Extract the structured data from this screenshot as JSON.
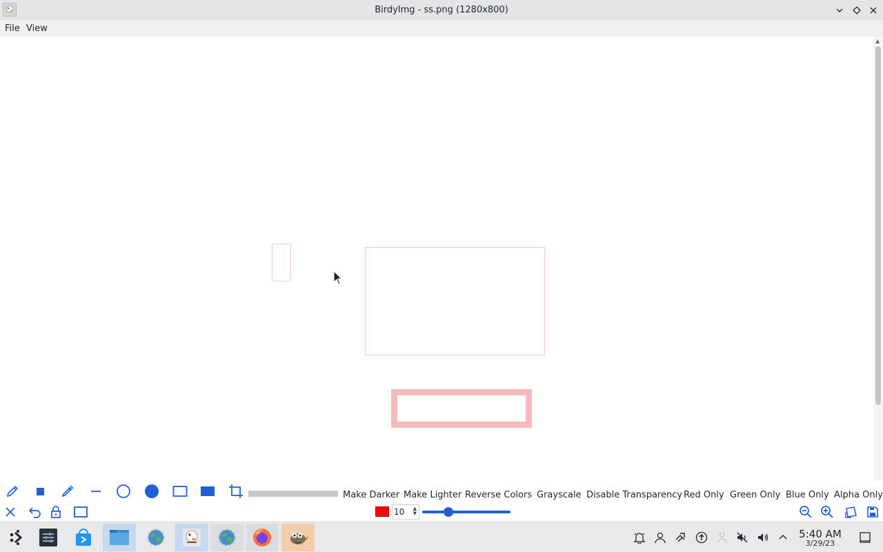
{
  "window": {
    "title": "BirdyImg - ss.png (1280x800)",
    "buttons": [
      "minimize",
      "maximize",
      "close"
    ]
  },
  "menu": {
    "items": [
      {
        "label": "File"
      },
      {
        "label": "View"
      }
    ]
  },
  "toolbar": {
    "tools": [
      {
        "name": "pencil-icon"
      },
      {
        "name": "filled-square-small-icon"
      },
      {
        "name": "eyedropper-icon"
      },
      {
        "name": "line-icon"
      },
      {
        "name": "circle-outline-icon"
      },
      {
        "name": "circle-filled-icon"
      },
      {
        "name": "rectangle-outline-icon"
      },
      {
        "name": "rectangle-filled-icon"
      },
      {
        "name": "crop-icon"
      }
    ],
    "filters": [
      {
        "label": "Make Darker"
      },
      {
        "label": "Make Lighter"
      },
      {
        "label": "Reverse Colors"
      },
      {
        "label": "Grayscale"
      },
      {
        "label": "Disable Transparency"
      },
      {
        "label": "Red Only"
      },
      {
        "label": "Green Only"
      },
      {
        "label": "Blue Only"
      },
      {
        "label": "Alpha Only"
      }
    ],
    "actions": [
      {
        "name": "close-icon"
      },
      {
        "name": "undo-icon"
      },
      {
        "name": "lock-icon"
      },
      {
        "name": "rectangle-select-icon"
      }
    ],
    "color": "#ff0000",
    "size": "10",
    "opacity_fraction": 0.3,
    "right_actions": [
      {
        "name": "zoom-out-icon"
      },
      {
        "name": "zoom-in-icon"
      },
      {
        "name": "rotate-icon"
      },
      {
        "name": "save-icon"
      }
    ]
  },
  "canvas": {
    "shape_colors": {
      "outline_light": "#f4c9c9",
      "outline_strong": "#f7b5b5"
    }
  },
  "taskbar": {
    "apps": [
      {
        "name": "application-launcher-icon"
      },
      {
        "name": "system-settings-icon"
      },
      {
        "name": "discover-store-icon"
      },
      {
        "name": "file-manager-icon"
      },
      {
        "name": "globe-browser-icon"
      },
      {
        "name": "birdyimg-app-icon"
      },
      {
        "name": "globe-network-icon"
      },
      {
        "name": "firefox-icon"
      },
      {
        "name": "gimp-icon"
      }
    ],
    "tray": [
      {
        "name": "notification-bell-icon"
      },
      {
        "name": "user-icon"
      },
      {
        "name": "kde-connect-icon"
      },
      {
        "name": "update-icon"
      },
      {
        "name": "network-disabled-icon"
      },
      {
        "name": "mute-icon"
      },
      {
        "name": "volume-icon"
      },
      {
        "name": "tray-expand-icon"
      }
    ],
    "clock_time": "5:40 AM",
    "clock_date": "3/29/23"
  }
}
